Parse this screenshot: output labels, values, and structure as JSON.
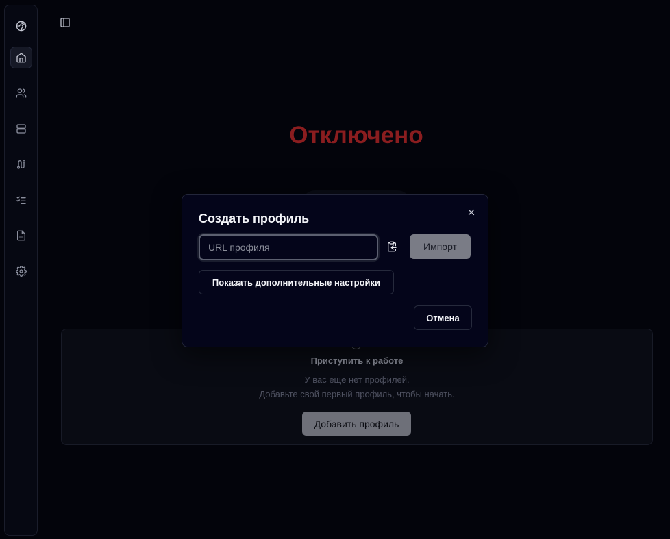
{
  "sidebar": {
    "items": [
      {
        "name": "globe-icon",
        "active": false
      },
      {
        "name": "home-icon",
        "active": true
      },
      {
        "name": "users-icon",
        "active": false
      },
      {
        "name": "server-icon",
        "active": false
      },
      {
        "name": "route-icon",
        "active": false
      },
      {
        "name": "checklist-icon",
        "active": false
      },
      {
        "name": "file-text-icon",
        "active": false
      },
      {
        "name": "gear-icon",
        "active": false
      }
    ]
  },
  "header": {
    "toggle_icon": "sidebar-toggle-icon"
  },
  "main": {
    "status": "Отключено",
    "empty_state": {
      "title": "Приступить к работе",
      "line1": "У вас еще нет профилей.",
      "line2": "Добавьте свой первый профиль, чтобы начать.",
      "add_button": "Добавить профиль"
    }
  },
  "dialog": {
    "title": "Создать профиль",
    "url_placeholder": "URL профиля",
    "url_value": "",
    "import_button": "Импорт",
    "more_settings_button": "Показать дополнительные настройки",
    "cancel_button": "Отмена"
  },
  "colors": {
    "status_red": "#8a1d1f",
    "background": "#03040b",
    "dialog_bg": "#04051a"
  }
}
